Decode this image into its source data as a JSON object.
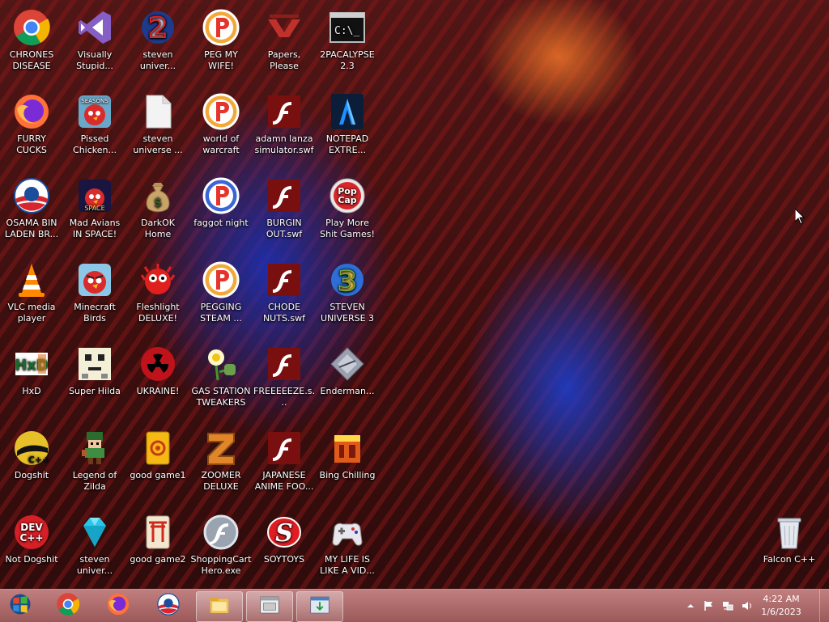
{
  "desktop": {
    "icons": [
      {
        "label": "CHRONES DISEASE",
        "icon": "chrome-icon"
      },
      {
        "label": "Visually Stupid...",
        "icon": "visual-studio-icon"
      },
      {
        "label": "steven univer...",
        "icon": "number-2-icon"
      },
      {
        "label": "PEG MY WIFE!",
        "icon": "peggle-icon"
      },
      {
        "label": "Papers, Please",
        "icon": "papers-please-icon"
      },
      {
        "label": "2PACALYPSE 2.3",
        "icon": "terminal-icon"
      },
      {
        "label": "FURRY CUCKS",
        "icon": "firefox-icon"
      },
      {
        "label": "Pissed Chicken...",
        "icon": "angry-birds-seasons-icon"
      },
      {
        "label": "steven universe ...",
        "icon": "blank-file-icon"
      },
      {
        "label": "world of warcraft",
        "icon": "peggle-icon"
      },
      {
        "label": "adamn lanza simulator.swf",
        "icon": "flash-icon"
      },
      {
        "label": "NOTEPAD EXTRE...",
        "icon": "notepad-extreme-icon"
      },
      {
        "label": "OSAMA BIN LADEN BR...",
        "icon": "obama-logo-icon"
      },
      {
        "label": "Mad Avians IN SPACE!",
        "icon": "angry-birds-space-icon"
      },
      {
        "label": "DarkOK Home",
        "icon": "money-bag-icon"
      },
      {
        "label": "faggot night",
        "icon": "peggle-nights-icon"
      },
      {
        "label": "BURGIN OUT.swf",
        "icon": "flash-icon"
      },
      {
        "label": "Play More Shit Games!",
        "icon": "popcap-icon"
      },
      {
        "label": "VLC media player",
        "icon": "vlc-cone-icon"
      },
      {
        "label": "Minecraft Birds",
        "icon": "angry-bird-icon"
      },
      {
        "label": "Fleshlight DELUXE!",
        "icon": "red-fuzzy-creature-icon"
      },
      {
        "label": "PEGGING STEAM ...",
        "icon": "peggle-icon"
      },
      {
        "label": "CHODE NUTS.swf",
        "icon": "flash-icon"
      },
      {
        "label": "STEVEN UNIVERSE 3",
        "icon": "number-3-icon"
      },
      {
        "label": "HxD",
        "icon": "hxd-icon"
      },
      {
        "label": "Super Hilda",
        "icon": "pixel-dog-icon"
      },
      {
        "label": "UKRAINE!",
        "icon": "radiation-icon"
      },
      {
        "label": "GAS STATION TWEAKERS",
        "icon": "plants-vs-zombies-icon"
      },
      {
        "label": "FREEEEEZE.s...",
        "icon": "flash-icon"
      },
      {
        "label": "Enderman...",
        "icon": "ender-diamond-icon"
      },
      {
        "label": "Dogshit",
        "icon": "cpp-icon"
      },
      {
        "label": "Legend of Zilda",
        "icon": "pixel-hero-icon"
      },
      {
        "label": "good game1",
        "icon": "mahjong-tile-icon"
      },
      {
        "label": "ZOOMER DELUXE",
        "icon": "zuma-icon"
      },
      {
        "label": "JAPANESE ANIME FOO...",
        "icon": "flash-icon"
      },
      {
        "label": "Bing Chilling",
        "icon": "orange-box-icon"
      },
      {
        "label": "Not Dogshit",
        "icon": "dev-cpp-icon"
      },
      {
        "label": "steven univer...",
        "icon": "diamond-icon"
      },
      {
        "label": "good game2",
        "icon": "torii-tile-icon"
      },
      {
        "label": "ShoppingCart Hero.exe",
        "icon": "flash-player-icon"
      },
      {
        "label": "SOYTOYS",
        "icon": "red-s-icon"
      },
      {
        "label": "MY LIFE IS LIKE A VID...",
        "icon": "gamepad-icon"
      }
    ],
    "recycle_bin": {
      "label": "Falcon C++",
      "icon": "recycle-bin-icon"
    }
  },
  "taskbar": {
    "start_icon": "start-orb-icon",
    "pinned": [
      {
        "icon": "chrome-icon"
      },
      {
        "icon": "firefox-icon"
      },
      {
        "icon": "obama-logo-icon"
      },
      {
        "icon": "file-explorer-icon"
      },
      {
        "icon": "archive-window-icon"
      },
      {
        "icon": "download-window-icon"
      }
    ],
    "tray": [
      {
        "icon": "show-hidden-icons-icon"
      },
      {
        "icon": "flag-icon"
      },
      {
        "icon": "network-icon"
      },
      {
        "icon": "volume-icon"
      }
    ],
    "clock": {
      "time": "4:22 AM",
      "date": "1/6/2023"
    }
  }
}
